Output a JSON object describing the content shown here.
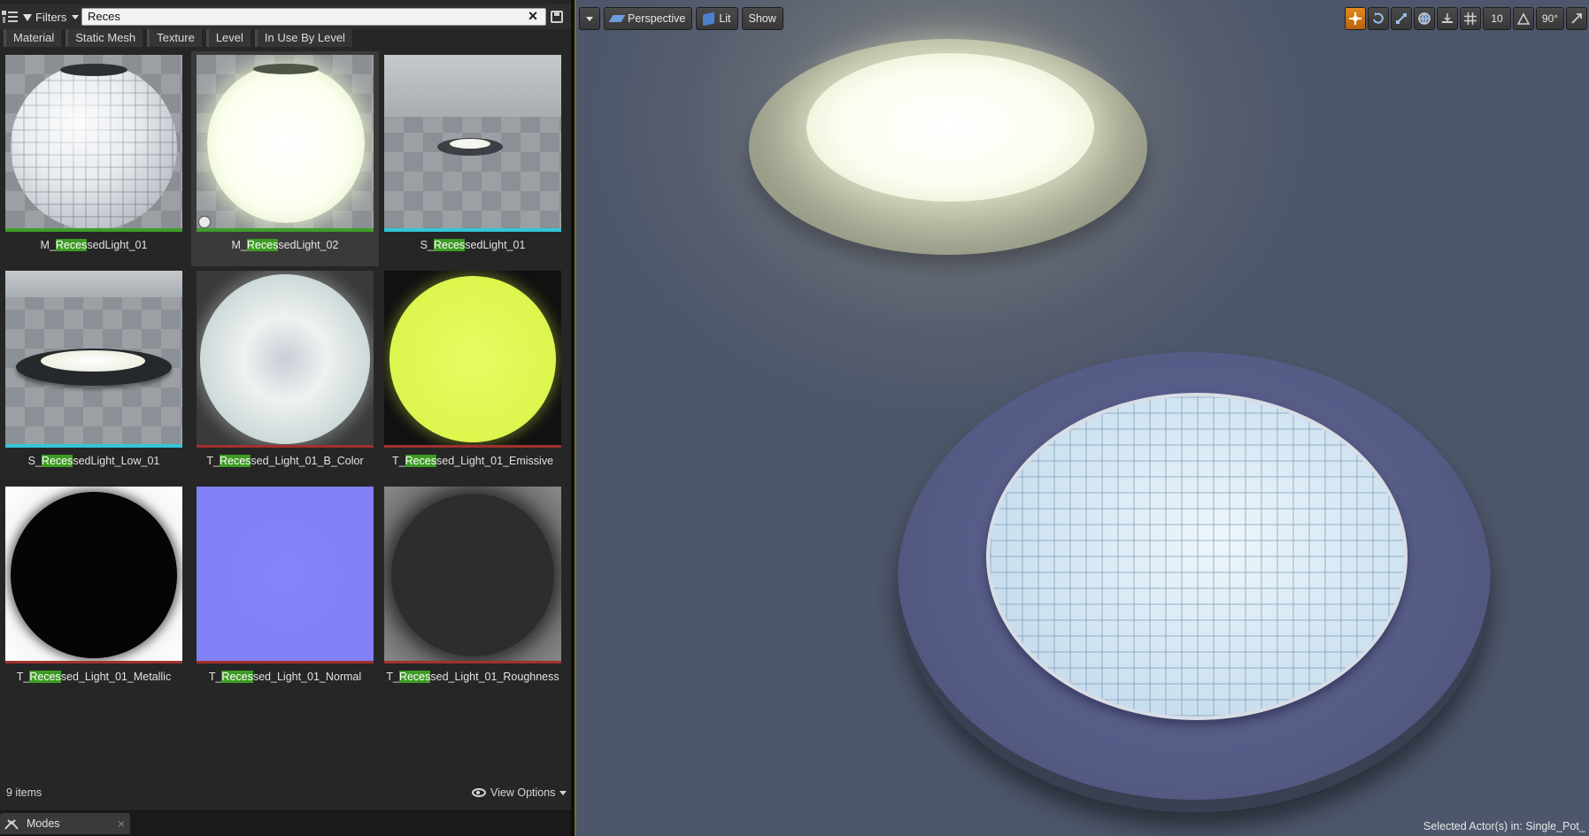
{
  "search": {
    "filters_label": "Filters",
    "query": "Reces"
  },
  "filter_chips": [
    "Material",
    "Static Mesh",
    "Texture",
    "Level",
    "In Use By Level"
  ],
  "assets": [
    {
      "pre": "M_",
      "hl": "Reces",
      "post": "sedLight_01"
    },
    {
      "pre": "M_",
      "hl": "Reces",
      "post": "sedLight_02"
    },
    {
      "pre": "S_",
      "hl": "Reces",
      "post": "sedLight_01"
    },
    {
      "pre": "S_",
      "hl": "Reces",
      "post": "sedLight_Low_01"
    },
    {
      "pre": "T_",
      "hl": "Reces",
      "post": "sed_Light_01_B_Color"
    },
    {
      "pre": "T_",
      "hl": "Reces",
      "post": "sed_Light_01_Emissive"
    },
    {
      "pre": "T_",
      "hl": "Reces",
      "post": "sed_Light_01_Metallic"
    },
    {
      "pre": "T_",
      "hl": "Reces",
      "post": "sed_Light_01_Normal"
    },
    {
      "pre": "T_",
      "hl": "Reces",
      "post": "sed_Light_01_Roughness"
    }
  ],
  "status": {
    "item_count": "9 items",
    "view_options": "View Options"
  },
  "modes_tab": {
    "label": "Modes"
  },
  "viewport": {
    "perspective": "Perspective",
    "lit": "Lit",
    "show": "Show",
    "grid_snap": "10",
    "angle_snap": "90°",
    "selected_actor": "Selected Actor(s) in:  Single_Pot_"
  },
  "colors": {
    "material_bar": "#3f9e2a",
    "mesh_bar": "#33c6d6",
    "texture_bar": "#a3302d",
    "highlight": "#3e9b25",
    "accent": "#e08a1a"
  }
}
